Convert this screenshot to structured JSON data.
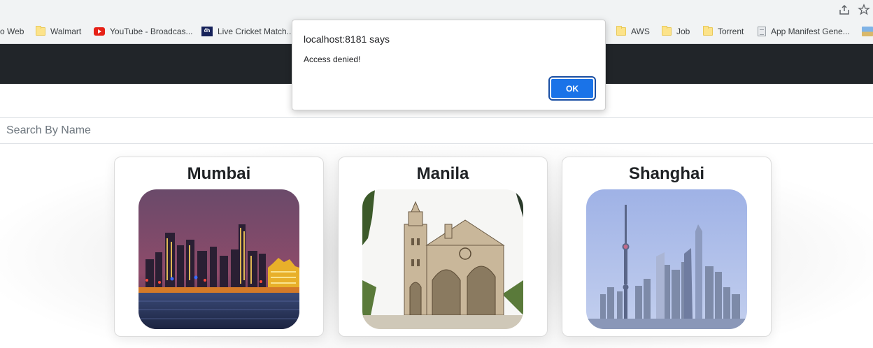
{
  "bookmarks": [
    {
      "label": "o Web",
      "icon": "none"
    },
    {
      "label": "Walmart",
      "icon": "folder-icon"
    },
    {
      "label": "YouTube - Broadcas...",
      "icon": "youtube-icon"
    },
    {
      "label": "Live Cricket Match...",
      "icon": "dh-icon"
    },
    {
      "label": "AWS",
      "icon": "folder-icon"
    },
    {
      "label": "Job",
      "icon": "folder-icon"
    },
    {
      "label": "Torrent",
      "icon": "folder-icon"
    },
    {
      "label": "App Manifest Gene...",
      "icon": "document-icon"
    }
  ],
  "alert": {
    "title": "localhost:8181 says",
    "message": "Access denied!",
    "ok_label": "OK"
  },
  "search": {
    "placeholder": "Search By Name",
    "value": ""
  },
  "cities": [
    {
      "name": "Mumbai"
    },
    {
      "name": "Manila"
    },
    {
      "name": "Shanghai"
    }
  ],
  "colors": {
    "header_bg": "#212529",
    "button_blue": "#1a73e8",
    "browser_chrome": "#f1f3f4"
  }
}
